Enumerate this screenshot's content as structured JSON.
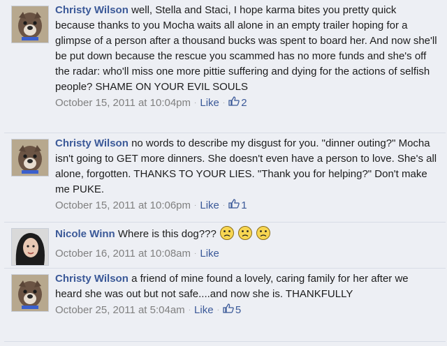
{
  "comments": [
    {
      "author": "Christy Wilson",
      "text": "well, Stella and Staci, I hope karma bites you pretty quick because thanks to you Mocha waits all alone in an empty trailer hoping for a glimpse of a person after a thousand bucks was spent to board her. And now she'll be put down because the rescue you scammed has no more funds and she's off the radar: who'll miss one more pittie suffering and dying for the actions of selfish people? SHAME ON YOUR EVIL SOULS",
      "timestamp": "October 15, 2011 at 10:04pm",
      "like_label": "Like",
      "like_count": "2"
    },
    {
      "author": "Christy Wilson",
      "text": "no words to describe my disgust for you. \"dinner outing?\" Mocha isn't going to GET more dinners. She doesn't even have a person to love. She's all alone, forgotten. THANKS TO YOUR LIES. \"Thank you for helping?\" Don't make me PUKE.",
      "timestamp": "October 15, 2011 at 10:06pm",
      "like_label": "Like",
      "like_count": "1"
    },
    {
      "author": "Nicole Winn",
      "text": "Where is this dog???",
      "timestamp": "October 16, 2011 at 10:08am",
      "like_label": "Like",
      "emoji": [
        "frown-emoticon",
        "frown-emoticon",
        "frown-emoticon"
      ]
    },
    {
      "author": "Christy Wilson",
      "text": "a friend of mine found a lovely, caring family for her after we heard she was out but not safe....and now she is. THANKFULLY",
      "timestamp": "October 25, 2011 at 5:04am",
      "like_label": "Like",
      "like_count": "5"
    }
  ],
  "icons": {
    "thumb": "thumbs-up-icon",
    "separator": "middle-dot"
  },
  "colors": {
    "background": "#edeff4",
    "link": "#3b5998",
    "meta": "#808080"
  }
}
